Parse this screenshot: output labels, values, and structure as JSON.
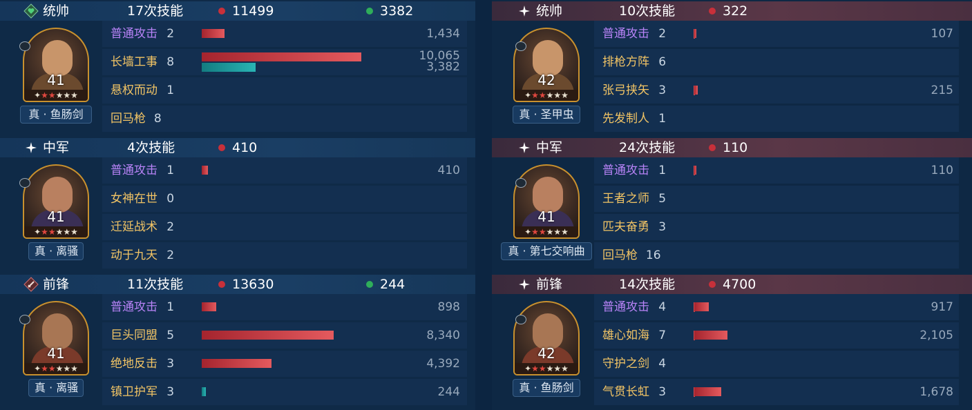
{
  "left": {
    "blocks": [
      {
        "role": "统帅",
        "role_icon": "heart-shield-icon",
        "casts": "17次技能",
        "damage": "11499",
        "heal": "3382",
        "level": "41",
        "stars": "★★★★★",
        "equip": "真 · 鱼肠剑",
        "skills": [
          {
            "name": "普通攻击",
            "count": "2",
            "value": "1,434",
            "color": "purple",
            "damage_fraction": 0.142
          },
          {
            "name": "长墙工事",
            "count": "8",
            "value": "10,065",
            "value2": "3,382",
            "color": "gold",
            "damage_fraction": 1.0,
            "heal_fraction": 0.336
          },
          {
            "name": "悬权而动",
            "count": "1",
            "value": "",
            "color": "gold"
          },
          {
            "name": "回马枪",
            "count": "8",
            "value": "",
            "color": "gold"
          }
        ]
      },
      {
        "role": "中军",
        "role_icon": "sparkle-icon",
        "casts": "4次技能",
        "damage": "410",
        "heal": "",
        "level": "41",
        "stars": "★★★★★",
        "equip": "真 · 离骚",
        "skills": [
          {
            "name": "普通攻击",
            "count": "1",
            "value": "410",
            "color": "purple",
            "damage_fraction": 0.04
          },
          {
            "name": "女神在世",
            "count": "0",
            "value": "",
            "color": "gold"
          },
          {
            "name": "迁延战术",
            "count": "2",
            "value": "",
            "color": "gold"
          },
          {
            "name": "动于九天",
            "count": "2",
            "value": "",
            "color": "gold"
          }
        ]
      },
      {
        "role": "前锋",
        "role_icon": "sword-icon",
        "casts": "11次技能",
        "damage": "13630",
        "heal": "244",
        "level": "41",
        "stars": "★★★★★",
        "equip": "真 · 离骚",
        "skills": [
          {
            "name": "普通攻击",
            "count": "1",
            "value": "898",
            "color": "purple",
            "damage_fraction": 0.089
          },
          {
            "name": "巨头同盟",
            "count": "5",
            "value": "8,340",
            "color": "gold",
            "damage_fraction": 0.829
          },
          {
            "name": "绝地反击",
            "count": "3",
            "value": "4,392",
            "color": "gold",
            "damage_fraction": 0.436
          },
          {
            "name": "镇卫护军",
            "count": "3",
            "value": "244",
            "color": "gold",
            "heal_fraction": 0.024
          }
        ]
      }
    ]
  },
  "right": {
    "blocks": [
      {
        "role": "统帅",
        "role_icon": "sparkle-icon",
        "casts": "10次技能",
        "damage": "322",
        "heal": "",
        "level": "42",
        "stars": "★★★★★",
        "equip": "真 · 圣甲虫",
        "skills": [
          {
            "name": "普通攻击",
            "count": "2",
            "value": "107",
            "color": "purple",
            "damage_fraction": 0.011
          },
          {
            "name": "排枪方阵",
            "count": "6",
            "value": "",
            "color": "gold"
          },
          {
            "name": "张弓挟矢",
            "count": "3",
            "value": "215",
            "color": "gold",
            "damage_fraction": 0.021
          },
          {
            "name": "先发制人",
            "count": "1",
            "value": "",
            "color": "gold"
          }
        ]
      },
      {
        "role": "中军",
        "role_icon": "sparkle-icon",
        "casts": "24次技能",
        "damage": "110",
        "heal": "",
        "level": "41",
        "stars": "★★★★★",
        "equip": "真 · 第七交响曲",
        "skills": [
          {
            "name": "普通攻击",
            "count": "1",
            "value": "110",
            "color": "purple",
            "damage_fraction": 0.011
          },
          {
            "name": "王者之师",
            "count": "5",
            "value": "",
            "color": "gold"
          },
          {
            "name": "匹夫奋勇",
            "count": "3",
            "value": "",
            "color": "gold"
          },
          {
            "name": "回马枪",
            "count": "16",
            "value": "",
            "color": "gold"
          }
        ]
      },
      {
        "role": "前锋",
        "role_icon": "sparkle-icon",
        "casts": "14次技能",
        "damage": "4700",
        "heal": "",
        "level": "42",
        "stars": "★★★★★",
        "equip": "真 · 鱼肠剑",
        "skills": [
          {
            "name": "普通攻击",
            "count": "4",
            "value": "917",
            "color": "purple",
            "damage_fraction": 0.091
          },
          {
            "name": "雄心如海",
            "count": "7",
            "value": "2,105",
            "color": "gold",
            "damage_fraction": 0.209
          },
          {
            "name": "守护之剑",
            "count": "4",
            "value": "",
            "color": "gold"
          },
          {
            "name": "气贯长虹",
            "count": "3",
            "value": "1,678",
            "color": "gold",
            "damage_fraction": 0.167
          }
        ]
      }
    ]
  }
}
